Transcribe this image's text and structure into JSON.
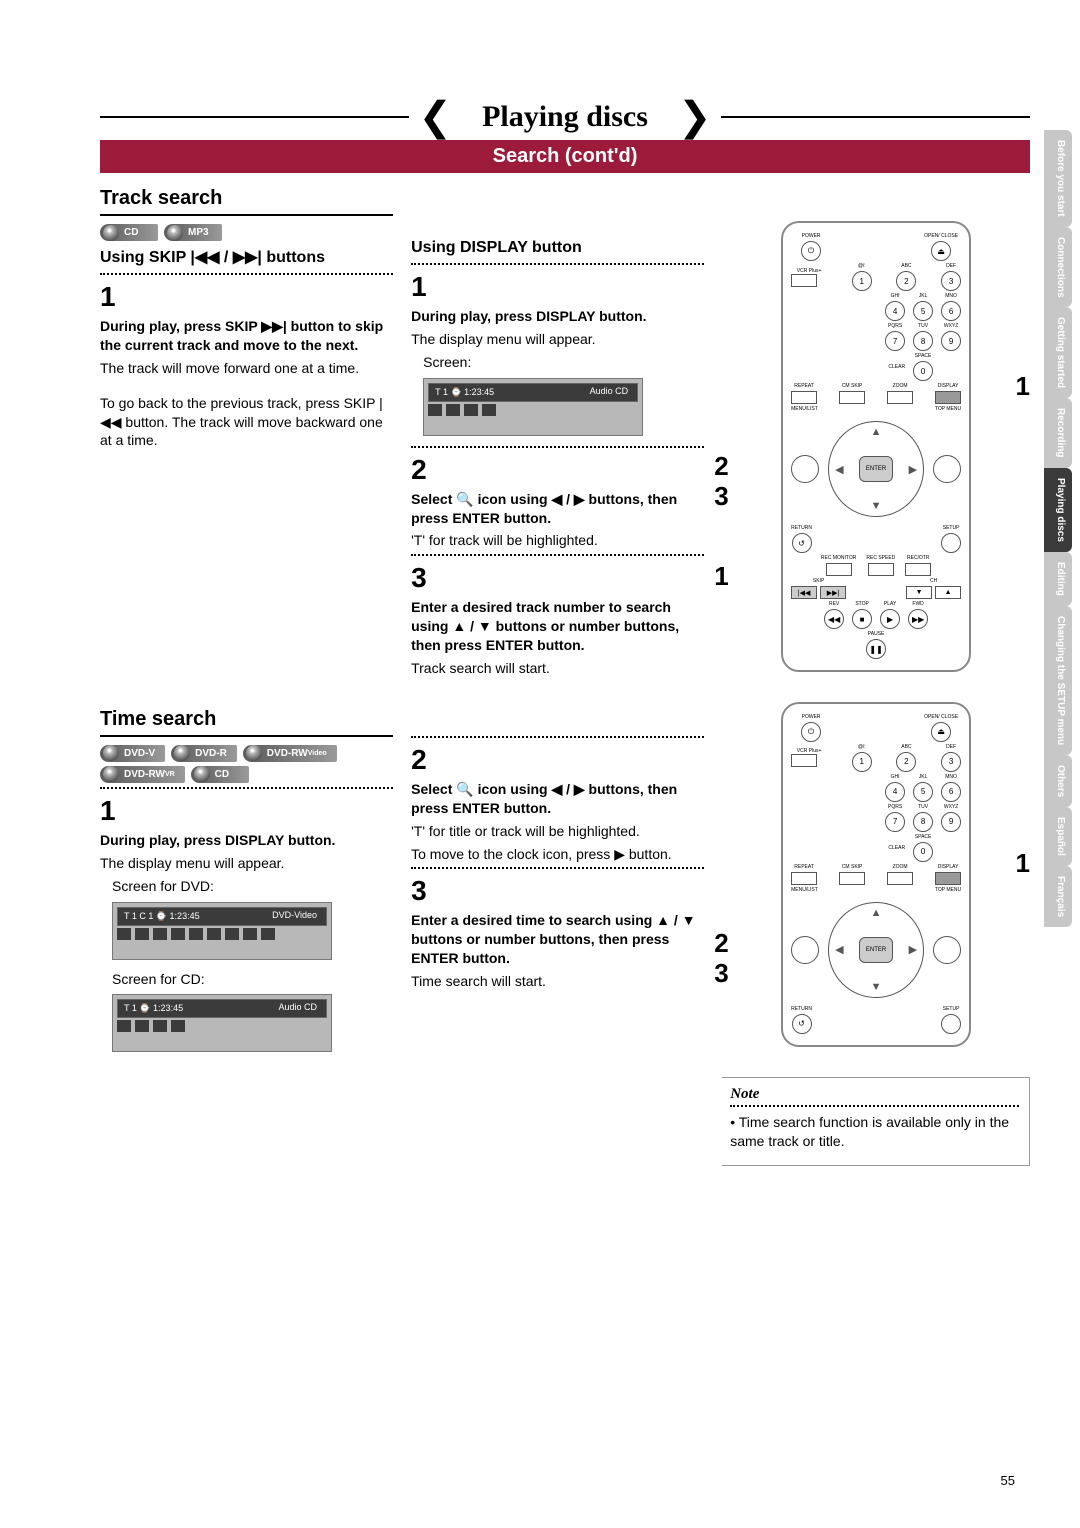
{
  "header": {
    "title": "Playing discs",
    "subtitle": "Search (cont'd)"
  },
  "side_tabs": {
    "items": [
      {
        "label": "Before you start",
        "active": false
      },
      {
        "label": "Connections",
        "active": false
      },
      {
        "label": "Getting started",
        "active": false
      },
      {
        "label": "Recording",
        "active": false
      },
      {
        "label": "Playing discs",
        "active": true
      },
      {
        "label": "Editing",
        "active": false
      },
      {
        "label": "Changing the SETUP menu",
        "active": false
      },
      {
        "label": "Others",
        "active": false
      },
      {
        "label": "Español",
        "active": false
      },
      {
        "label": "Français",
        "active": false
      }
    ]
  },
  "track_search": {
    "heading": "Track search",
    "badges": [
      "CD",
      "MP3"
    ],
    "skip_heading": "Using SKIP |◀◀ / ▶▶| buttons",
    "step1_num": "1",
    "step1_bold": "During play, press SKIP ▶▶| button to skip the current track and move to the next.",
    "step1_text": "The track will move forward one at a time.",
    "step1_text2": "To go back to the previous track, press SKIP |◀◀ button. The track will move backward one at a time."
  },
  "display_method": {
    "heading": "Using DISPLAY button",
    "step1_num": "1",
    "step1_bold": "During play, press DISPLAY button.",
    "step1_text": "The display menu will appear.",
    "step1_caption": "Screen:",
    "screen_cd": {
      "strip": "T   1  ⌚  1:23:45",
      "label": "Audio CD"
    },
    "step2_num": "2",
    "step2_bold": "Select  🔍  icon using ◀ / ▶ buttons, then press ENTER button.",
    "step2_text": "'T' for track will be highlighted.",
    "step3_num": "3",
    "step3_bold": "Enter a desired track number to search using ▲ / ▼ buttons or number buttons, then press ENTER button.",
    "step3_text": "Track search will start."
  },
  "time_search": {
    "heading": "Time search",
    "badges_row1": [
      "DVD-V",
      "DVD-R",
      "DVD-RW Video"
    ],
    "badges_row2": [
      "DVD-RW VR",
      "CD"
    ],
    "step1_num": "1",
    "step1_bold": "During play, press DISPLAY button.",
    "step1_text": "The display menu will appear.",
    "caption_dvd": "Screen for DVD:",
    "screen_dvd": {
      "strip": "T   1  C   1  ⌚  1:23:45",
      "label": "DVD-Video"
    },
    "caption_cd": "Screen for CD:",
    "screen_cd": {
      "strip": "T   1  ⌚  1:23:45",
      "label": "Audio CD"
    }
  },
  "time_search_right": {
    "step2_num": "2",
    "step2_bold": "Select  🔍  icon using ◀ / ▶ buttons, then press ENTER button.",
    "step2_text1": "'T' for title or track will be highlighted.",
    "step2_text2": "To move to the clock icon, press ▶ button.",
    "step3_num": "3",
    "step3_bold": "Enter a desired time to search using ▲ / ▼ buttons or number buttons, then press ENTER button.",
    "step3_text": "Time search will start."
  },
  "remote_callouts_upper": {
    "c1": "1",
    "c2": "2",
    "c3": "3",
    "lower1": "1"
  },
  "remote_callouts_lower": {
    "c1": "1",
    "c2": "2",
    "c3": "3"
  },
  "remote_labels": {
    "power": "POWER",
    "open": "OPEN/\nCLOSE",
    "vcrplus": "VCR Plus+",
    "row1": [
      "@/:",
      "ABC",
      "DEF"
    ],
    "row2": [
      "GHI",
      "JKL",
      "MNO"
    ],
    "row3": [
      "PQRS",
      "TUV",
      "WXYZ"
    ],
    "row4": [
      "CLEAR",
      "SPACE"
    ],
    "func_row": [
      "REPEAT",
      "CM SKIP",
      "ZOOM",
      "DISPLAY"
    ],
    "menu_row": [
      "MENU/LIST",
      "TOP MENU"
    ],
    "enter": "ENTER",
    "return": "RETURN",
    "setup": "SETUP",
    "rec_row": [
      "REC MONITOR",
      "REC SPEED",
      "REC/OTR"
    ],
    "skip": "SKIP",
    "ch": "CH",
    "play_row": [
      "REV",
      "STOP",
      "PLAY",
      "FWD"
    ],
    "pause": "PAUSE"
  },
  "note": {
    "label": "Note",
    "text": "• Time search function is available only in the same track or title."
  },
  "page_number": "55"
}
